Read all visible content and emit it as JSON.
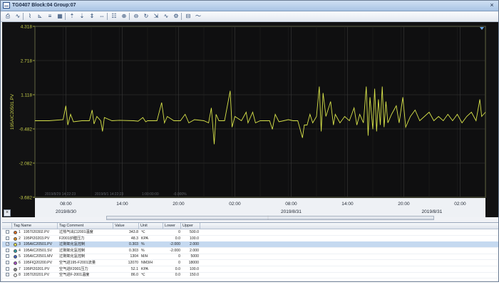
{
  "window": {
    "title": "TG0407 Block:04 Group:07",
    "close_label": "×"
  },
  "toolbar": {
    "buttons": [
      {
        "name": "print-icon",
        "glyph": "⎙"
      },
      {
        "name": "trend-chart-icon",
        "glyph": "∿"
      },
      {
        "name": "cursor-chart-icon",
        "glyph": "⌇"
      },
      {
        "name": "trend-cursor-icon",
        "glyph": "⊾"
      },
      {
        "name": "ruler-icon",
        "glyph": "≡"
      },
      {
        "name": "grid-icon",
        "glyph": "▦"
      },
      {
        "name": "scale-up-icon",
        "glyph": "⇡"
      },
      {
        "name": "scale-down-icon",
        "glyph": "⇣"
      },
      {
        "name": "scale-fit-icon",
        "glyph": "⇕"
      },
      {
        "name": "pan-icon",
        "glyph": "⇔"
      },
      {
        "name": "overlay-icon",
        "glyph": "☷"
      },
      {
        "name": "zoom-in-icon",
        "glyph": "⊕"
      },
      {
        "name": "zoom-out-icon",
        "glyph": "⊖"
      },
      {
        "name": "refresh-icon",
        "glyph": "↻"
      },
      {
        "name": "export-icon",
        "glyph": "⇲"
      },
      {
        "name": "pen-chart-icon",
        "glyph": "∿"
      },
      {
        "name": "settings-icon",
        "glyph": "⚙"
      },
      {
        "name": "tag-icon",
        "glyph": "⊟"
      },
      {
        "name": "wave-icon",
        "glyph": "〜"
      }
    ]
  },
  "chart_data": {
    "type": "line",
    "ylabel": "195AIC20501.PV",
    "yticks": [
      "4.318",
      "2.718",
      "1.118",
      "-0.482",
      "-2.082",
      "-3.682"
    ],
    "ylim": [
      -3.682,
      4.318
    ],
    "xlim": [
      0,
      48
    ],
    "time_ticks": [
      "08:00",
      "14:00",
      "20:00",
      "02:00",
      "08:00",
      "14:00",
      "20:00",
      "02:00"
    ],
    "date_ticks": [
      "2019/8/30",
      "2019/8/31",
      "2019/8/31"
    ],
    "cursor_readout": [
      "2019/8/29 14:22:23",
      "2019/9/1 14:22:23",
      "1:00:00:00",
      "-0.000%"
    ],
    "grid": true,
    "line_color": "#d7e24a",
    "series": [
      {
        "values": [
          [
            0,
            -0.1
          ],
          [
            1.5,
            -0.1
          ],
          [
            3,
            -0.05
          ],
          [
            3.3,
            0.6
          ],
          [
            3.5,
            -0.3
          ],
          [
            3.8,
            0.2
          ],
          [
            4.1,
            -0.15
          ],
          [
            5,
            -0.1
          ],
          [
            5.8,
            -0.1
          ],
          [
            6.1,
            0.4
          ],
          [
            6.3,
            -0.25
          ],
          [
            6.6,
            0.1
          ],
          [
            7,
            -0.1
          ],
          [
            7.2,
            -0.6
          ],
          [
            7.4,
            0.05
          ],
          [
            8.2,
            -0.1
          ],
          [
            9,
            -0.08
          ],
          [
            10.5,
            -0.1
          ],
          [
            11,
            -0.12
          ],
          [
            11.5,
            0.05
          ],
          [
            11.8,
            -0.15
          ],
          [
            12,
            -0.1
          ],
          [
            13,
            -0.1
          ],
          [
            13.5,
            0.75
          ],
          [
            13.8,
            -0.2
          ],
          [
            14.1,
            0.1
          ],
          [
            14.8,
            -0.1
          ],
          [
            15.5,
            -0.1
          ],
          [
            16,
            0.2
          ],
          [
            16.4,
            -0.2
          ],
          [
            17,
            -0.05
          ],
          [
            18,
            -0.1
          ],
          [
            18.5,
            -0.2
          ],
          [
            18.8,
            0.5
          ],
          [
            19.1,
            -1.2
          ],
          [
            19.3,
            0.2
          ],
          [
            19.6,
            -0.1
          ],
          [
            20.2,
            -0.1
          ],
          [
            20.8,
            1.3
          ],
          [
            21,
            -0.4
          ],
          [
            21.3,
            0.1
          ],
          [
            22,
            -0.1
          ],
          [
            22.5,
            0.3
          ],
          [
            22.7,
            -0.2
          ],
          [
            23.2,
            0.3
          ],
          [
            23.5,
            -0.2
          ],
          [
            24,
            -0.1
          ],
          [
            25,
            -0.1
          ],
          [
            25.3,
            -0.5
          ],
          [
            25.6,
            0.2
          ],
          [
            26,
            -0.15
          ],
          [
            26.5,
            -0.1
          ],
          [
            27,
            -0.05
          ],
          [
            27.5,
            -0.1
          ],
          [
            28,
            -0.1
          ],
          [
            28.5,
            -0.9
          ],
          [
            28.7,
            -0.3
          ],
          [
            29,
            -0.3
          ],
          [
            29.3,
            0.2
          ],
          [
            29.6,
            -0.2
          ],
          [
            30,
            0.1
          ],
          [
            30.3,
            1.5
          ],
          [
            30.5,
            -0.6
          ],
          [
            30.7,
            1.2
          ],
          [
            31,
            0.1
          ],
          [
            31.5,
            0.8
          ],
          [
            31.8,
            -0.3
          ],
          [
            32,
            0.2
          ],
          [
            32.5,
            -0.2
          ],
          [
            33,
            0.1
          ],
          [
            33.5,
            -0.1
          ],
          [
            34,
            0.5
          ],
          [
            34.3,
            -0.3
          ],
          [
            34.6,
            0.2
          ],
          [
            35,
            -0.2
          ],
          [
            35.3,
            1.5
          ],
          [
            35.5,
            -0.8
          ],
          [
            35.7,
            1.0
          ],
          [
            36,
            -0.5
          ],
          [
            36.2,
            1.4
          ],
          [
            36.4,
            -0.6
          ],
          [
            36.6,
            0.9
          ],
          [
            36.8,
            -0.3
          ],
          [
            37,
            1.5
          ],
          [
            37.2,
            -0.4
          ],
          [
            37.4,
            0.8
          ],
          [
            37.6,
            -0.2
          ],
          [
            38,
            0.2
          ],
          [
            38.5,
            0.6
          ],
          [
            38.8,
            -0.2
          ],
          [
            39.2,
            1.0
          ],
          [
            39.5,
            -0.4
          ],
          [
            40,
            0.1
          ],
          [
            40.5,
            0.4
          ],
          [
            41,
            -0.1
          ],
          [
            41.5,
            0.1
          ],
          [
            42,
            0.3
          ],
          [
            42.5,
            -0.1
          ],
          [
            43,
            0.1
          ],
          [
            43.5,
            -0.1
          ],
          [
            44,
            0.2
          ],
          [
            44.5,
            -0.1
          ],
          [
            45,
            0.2
          ],
          [
            45.5,
            -0.2
          ],
          [
            46,
            0.1
          ],
          [
            46.5,
            0.3
          ],
          [
            47,
            -0.1
          ],
          [
            47.4,
            0.9
          ],
          [
            47.6,
            0.1
          ],
          [
            48,
            0.3
          ]
        ]
      }
    ]
  },
  "table": {
    "columns": [
      "Tag Name",
      "Tag Comment",
      "Value",
      "Unit",
      "Lower",
      "Upper"
    ],
    "rows": [
      {
        "idx": "1",
        "tag": "195TI20302.PV",
        "comment": "过热气出口2001温度",
        "value": "343.8",
        "unit": "℃",
        "lower": "0",
        "upper": "500.0",
        "color": "#e06a1e",
        "checked": false,
        "selected": false
      },
      {
        "idx": "2",
        "tag": "195PI20203.PV",
        "comment": "F2001炉膛压力",
        "value": "48.3",
        "unit": "KPA",
        "lower": "0.0",
        "upper": "100.0",
        "color": "#d8891c",
        "checked": false,
        "selected": false
      },
      {
        "idx": "3",
        "tag": "195AIC20501.PV",
        "comment": "过剩氧化氢控制",
        "value": "0.303",
        "unit": "%",
        "lower": "-2.000",
        "upper": "2.000",
        "color": "#e4e04a",
        "checked": true,
        "selected": true
      },
      {
        "idx": "4",
        "tag": "195AIC20501.SV",
        "comment": "过剩氧化氢控制",
        "value": "0.303",
        "unit": "%",
        "lower": "-2.000",
        "upper": "2.000",
        "color": "#2d9fa6",
        "checked": false,
        "selected": false
      },
      {
        "idx": "5",
        "tag": "195AIC20501.MV",
        "comment": "过剩氧化氢控制",
        "value": "1304",
        "unit": "M/H",
        "lower": "0",
        "upper": "5000",
        "color": "#3f5ec4",
        "checked": false,
        "selected": false
      },
      {
        "idx": "6",
        "tag": "195FIQ20200.PV",
        "comment": "空气进195-F2001流量",
        "value": "12070",
        "unit": "NM3/H",
        "lower": "0",
        "upper": "18000",
        "color": "#a84cc8",
        "checked": false,
        "selected": false
      },
      {
        "idx": "7",
        "tag": "195PI20201.PV",
        "comment": "空气进F2001压力",
        "value": "52.1",
        "unit": "KPA",
        "lower": "0.0",
        "upper": "100.0",
        "color": "#8a8a8a",
        "checked": false,
        "selected": false
      },
      {
        "idx": "8",
        "tag": "195TI20201.PV",
        "comment": "空气进F-2001温度",
        "value": "86.0",
        "unit": "℃",
        "lower": "0.0",
        "upper": "150.0",
        "color": "#ffffff",
        "checked": false,
        "selected": false
      }
    ]
  }
}
